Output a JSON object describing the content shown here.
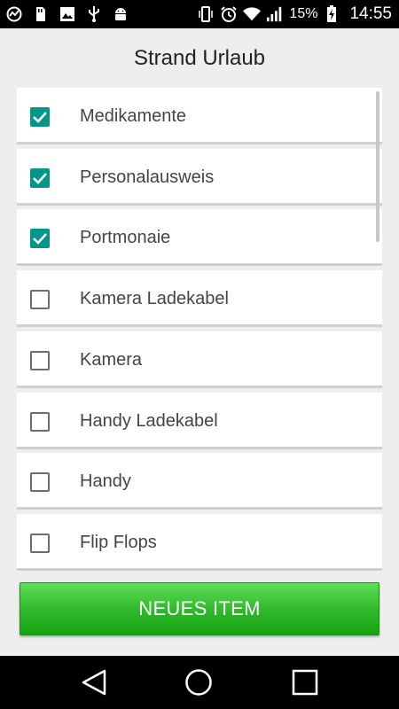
{
  "status_bar": {
    "left_icons": [
      "sync-icon",
      "sd-card-icon",
      "image-icon",
      "usb-icon",
      "android-icon"
    ],
    "right_icons": [
      "vibrate-icon",
      "alarm-icon",
      "wifi-icon",
      "signal-icon",
      "battery-charging-icon"
    ],
    "battery_percent": "15%",
    "time": "14:55"
  },
  "title": "Strand Urlaub",
  "items": [
    {
      "label": "Medikamente",
      "checked": true
    },
    {
      "label": "Personalausweis",
      "checked": true
    },
    {
      "label": "Portmonaie",
      "checked": true
    },
    {
      "label": "Kamera Ladekabel",
      "checked": false
    },
    {
      "label": "Kamera",
      "checked": false
    },
    {
      "label": "Handy Ladekabel",
      "checked": false
    },
    {
      "label": "Handy",
      "checked": false
    },
    {
      "label": "Flip Flops",
      "checked": false
    }
  ],
  "button_label": "NEUES ITEM",
  "nav": {
    "back_icon": "back-triangle-icon",
    "home_icon": "home-circle-icon",
    "recents_icon": "recents-square-icon"
  },
  "colors": {
    "checkbox_checked": "#00968a",
    "button_green": "#2fb62a",
    "background": "#eeeeee"
  }
}
